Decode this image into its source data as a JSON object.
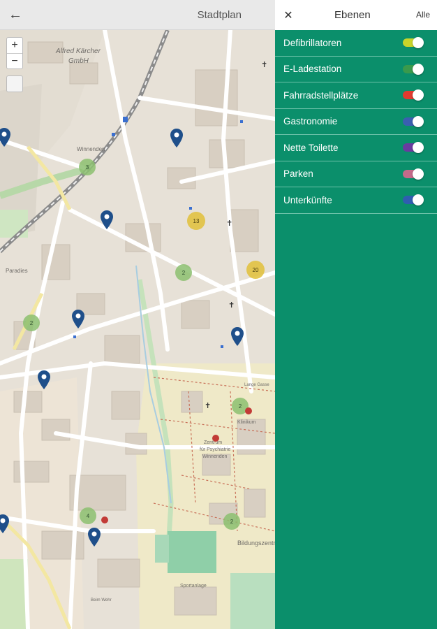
{
  "map_panel": {
    "back_icon": "arrow-left-icon",
    "title": "Stadtplan",
    "zoom_in": "+",
    "zoom_out": "−",
    "labels": {
      "kaercher": "Alfred Kärcher",
      "gmbh": "GmbH",
      "winnenden": "Winnenden",
      "paradies": "Paradies",
      "zentrum": "Zentrum",
      "psych": "für Psychiatrie",
      "winn2": "Winnenden",
      "klinik": "Klinikum",
      "bildung": "Bildungszentrum",
      "sport": "Sportanlage",
      "lange": "Lange Gasse",
      "beim": "Beim Wehr"
    },
    "clusters": [
      "3",
      "13",
      "2",
      "20",
      "2",
      "2",
      "4",
      "2"
    ]
  },
  "layers_panel": {
    "close_icon": "close-icon",
    "title": "Ebenen",
    "all_label": "Alle",
    "items": [
      {
        "label": "Defibrillatoren",
        "color": "#c8d42a"
      },
      {
        "label": "E-Ladestation",
        "color": "#3a9a4c"
      },
      {
        "label": "Fahrradstellplätze",
        "color": "#e03a2f"
      },
      {
        "label": "Gastronomie",
        "color": "#3a5fb0"
      },
      {
        "label": "Nette Toilette",
        "color": "#6a3aa0"
      },
      {
        "label": "Parken",
        "color": "#c46a8a"
      },
      {
        "label": "Unterkünfte",
        "color": "#2f5db0"
      }
    ]
  }
}
